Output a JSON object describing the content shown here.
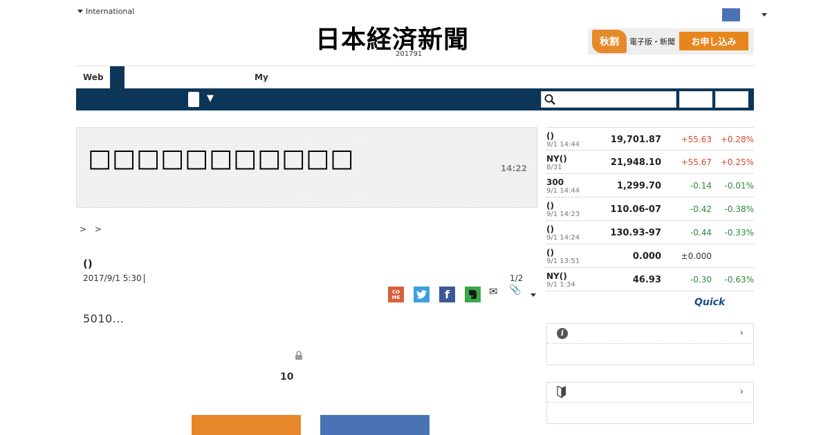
{
  "header": {
    "edition_label": "International",
    "logo_text": "日本経済新聞",
    "date_text": "201791",
    "promo": {
      "badge": "秋割",
      "text": "電子版・新聞",
      "button_label": "お申し込み"
    },
    "colors": {
      "navy": "#0c3658",
      "orange": "#e8861e",
      "flag_blue": "#4a73b5"
    }
  },
  "tabs": {
    "web_label": "Web",
    "my_label": "My"
  },
  "nav": {
    "dropdown_arrow": "▼",
    "search_icon": "search-icon",
    "search_placeholder": ""
  },
  "headline": {
    "text": "□□□□□□□□□□□",
    "time": "14:22"
  },
  "article": {
    "breadcrumb": "> >",
    "title": "()",
    "date": "2017/9/1 5:30",
    "page_count": "1/2",
    "excerpt": "5010...",
    "lock_count": "10",
    "share_icons": [
      "come-icon",
      "twitter-icon",
      "facebook-icon",
      "evernote-icon",
      "mail-icon",
      "clip-icon"
    ]
  },
  "market": {
    "rows": [
      {
        "name": "()",
        "time": "9/1 14:44",
        "value": "19,701.87",
        "change": "+55.63",
        "pct": "+0.28%",
        "trend": "pos"
      },
      {
        "name": "NY()",
        "time": "8/31",
        "value": "21,948.10",
        "change": "+55.67",
        "pct": "+0.25%",
        "trend": "pos"
      },
      {
        "name": "300",
        "time": "9/1 14:44",
        "value": "1,299.70",
        "change": "-0.14",
        "pct": "-0.01%",
        "trend": "neg"
      },
      {
        "name": "()",
        "time": "9/1 14:23",
        "value": "110.06-07",
        "change": "-0.42",
        "pct": "-0.38%",
        "trend": "neg"
      },
      {
        "name": "()",
        "time": "9/1 14:24",
        "value": "130.93-97",
        "change": "-0.44",
        "pct": "-0.33%",
        "trend": "neg"
      },
      {
        "name": "()",
        "time": "9/1 13:51",
        "value": "0.000",
        "change": "±0.000",
        "pct": "",
        "trend": "flat"
      },
      {
        "name": "NY()",
        "time": "9/1 1:34",
        "value": "46.93",
        "change": "-0.30",
        "pct": "-0.63%",
        "trend": "neg"
      }
    ],
    "source_label": "Quick"
  },
  "widgets": {
    "info_chevron": "›",
    "beginner_chevron": "›"
  }
}
